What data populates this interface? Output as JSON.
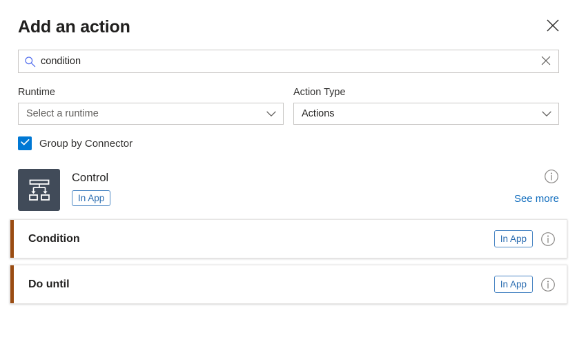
{
  "header": {
    "title": "Add an action",
    "close_icon": "close-icon"
  },
  "search": {
    "value": "condition",
    "placeholder": "Search",
    "search_icon": "search-icon",
    "clear_icon": "clear-icon"
  },
  "filters": [
    {
      "label": "Runtime",
      "value": "Select a runtime",
      "is_placeholder": true,
      "chevron_icon": "chevron-down-icon"
    },
    {
      "label": "Action Type",
      "value": "Actions",
      "is_placeholder": false,
      "chevron_icon": "chevron-down-icon"
    }
  ],
  "group_by": {
    "label": "Group by Connector",
    "checked": true,
    "check_icon": "check-icon"
  },
  "connector": {
    "name": "Control",
    "badge": "In App",
    "icon_name": "control-flow-icon",
    "info_icon": "info-icon",
    "see_more": "See more"
  },
  "actions": [
    {
      "name": "Condition",
      "badge": "In App",
      "info_icon": "info-icon",
      "accent_color": "#9a4c12"
    },
    {
      "name": "Do until",
      "badge": "In App",
      "info_icon": "info-icon",
      "accent_color": "#9a4c12"
    }
  ],
  "colors": {
    "accent_blue": "#0078d4",
    "link_blue": "#0f6cbd",
    "badge_blue": "#2a6cb0",
    "connector_tile": "#414b59",
    "action_accent": "#9a4c12",
    "search_icon_blue": "#4f6bed"
  }
}
